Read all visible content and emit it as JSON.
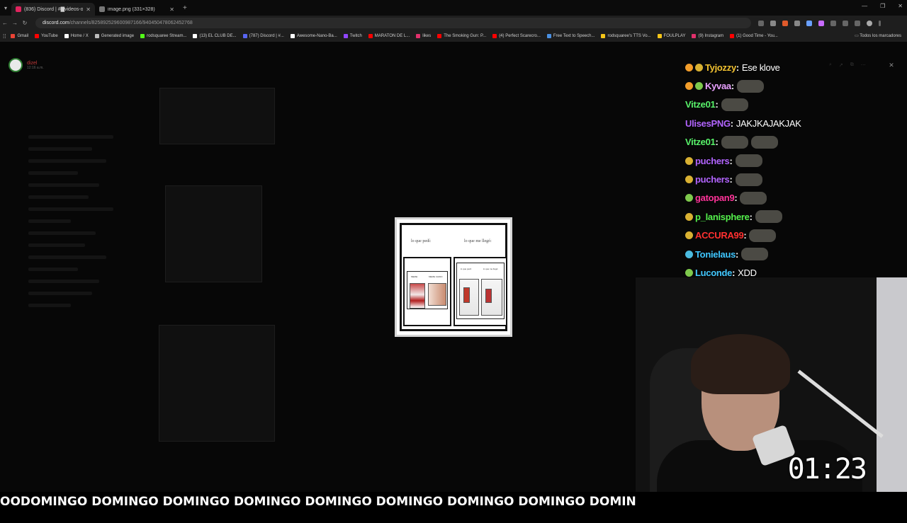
{
  "browser": {
    "tabs": [
      {
        "title": "(836) Discord | #▇videos-oro",
        "active": true,
        "favicon_color": "#e0245e"
      },
      {
        "title": "image.png (331×328)",
        "active": false,
        "favicon_color": "#777777"
      }
    ],
    "url_host": "discord.com",
    "url_path": "/channels/825892529600987166/940450478062452768",
    "bookmarks": [
      {
        "label": "Gmail",
        "color": "#ea4335"
      },
      {
        "label": "YouTube",
        "color": "#ff0000"
      },
      {
        "label": "Home / X",
        "color": "#ffffff"
      },
      {
        "label": "Generated image",
        "color": "#bbbbbb"
      },
      {
        "label": "rodsquaree Stream...",
        "color": "#53fc18"
      },
      {
        "label": "(13) EL CLUB DE...",
        "color": "#ffffff"
      },
      {
        "label": "(787) Discord | #...",
        "color": "#5865f2"
      },
      {
        "label": "Awesome-Nano-Ba...",
        "color": "#ffffff"
      },
      {
        "label": "Twitch",
        "color": "#9146ff"
      },
      {
        "label": "MARATON DE L...",
        "color": "#ff0000"
      },
      {
        "label": "likes",
        "color": "#e1306c"
      },
      {
        "label": "The Smoking Gun: P...",
        "color": "#ff0000"
      },
      {
        "label": "(4) Perfect Scarecro...",
        "color": "#ff0000"
      },
      {
        "label": "Free Text to Speech...",
        "color": "#4a90e2"
      },
      {
        "label": "rodsquaree's TTS Vo...",
        "color": "#f5c518"
      },
      {
        "label": "FOULPLAY",
        "color": "#f5c518"
      },
      {
        "label": "(9) Instagram",
        "color": "#e1306c"
      },
      {
        "label": "(1) Good Time - You...",
        "color": "#ff0000"
      }
    ],
    "bookmarks_all": "Todos los marcadores"
  },
  "discord": {
    "user": "dizel",
    "time": "12:16 a.m."
  },
  "viewer": {
    "label_left": "lo que pedí:",
    "label_right": "lo  que me llegó:",
    "inner_left_a": "MEME:",
    "inner_left_b": "MEME CHIDO",
    "inner_right_a": "lo que pedí:",
    "inner_right_b": "lo que me llegó:"
  },
  "chat": {
    "messages": [
      {
        "user": "Tyjozzy",
        "color": "#f2c230",
        "badges": [
          "b-alert",
          "b-emote"
        ],
        "text": "Ese klove",
        "emotes": 0
      },
      {
        "user": "Kyvaa",
        "color": "#e8a0ff",
        "badges": [
          "b-alert",
          "b-green"
        ],
        "text": "",
        "emotes": 1
      },
      {
        "user": "Vitze01",
        "color": "#58f36a",
        "badges": [],
        "text": "",
        "emotes": 1
      },
      {
        "user": "UlisesPNG",
        "color": "#b264ff",
        "badges": [],
        "text": "JAKJKAJAKJAK",
        "emotes": 0
      },
      {
        "user": "Vitze01",
        "color": "#58f36a",
        "badges": [],
        "text": "",
        "emotes": 2
      },
      {
        "user": "puchers",
        "color": "#b264ff",
        "badges": [
          "b-emote"
        ],
        "text": "",
        "emotes": 1
      },
      {
        "user": "puchers",
        "color": "#b264ff",
        "badges": [
          "b-emote"
        ],
        "text": "",
        "emotes": 1
      },
      {
        "user": "gatopan9",
        "color": "#ff3399",
        "badges": [
          "b-green"
        ],
        "text": "",
        "emotes": 1
      },
      {
        "user": "p_lanisphere",
        "color": "#54f04c",
        "badges": [
          "b-emote"
        ],
        "text": "",
        "emotes": 1
      },
      {
        "user": "ACCURA99",
        "color": "#ff3030",
        "badges": [
          "b-emote"
        ],
        "text": "",
        "emotes": 1
      },
      {
        "user": "Tonielaus",
        "color": "#3ec6ff",
        "badges": [
          "b-cyan"
        ],
        "text": "",
        "emotes": 1
      },
      {
        "user": "Luconde",
        "color": "#42c8ff",
        "badges": [
          "b-green"
        ],
        "text": "XDD",
        "emotes": 0
      }
    ]
  },
  "overlay": {
    "timer": "01:23",
    "ticker": "OODOMINGO DOMINGO DOMINGO DOMINGO DOMINGO DOMINGO DOMINGO DOMINGO DOMINGO DOMINGO DOMINGO DOMINGO D"
  }
}
